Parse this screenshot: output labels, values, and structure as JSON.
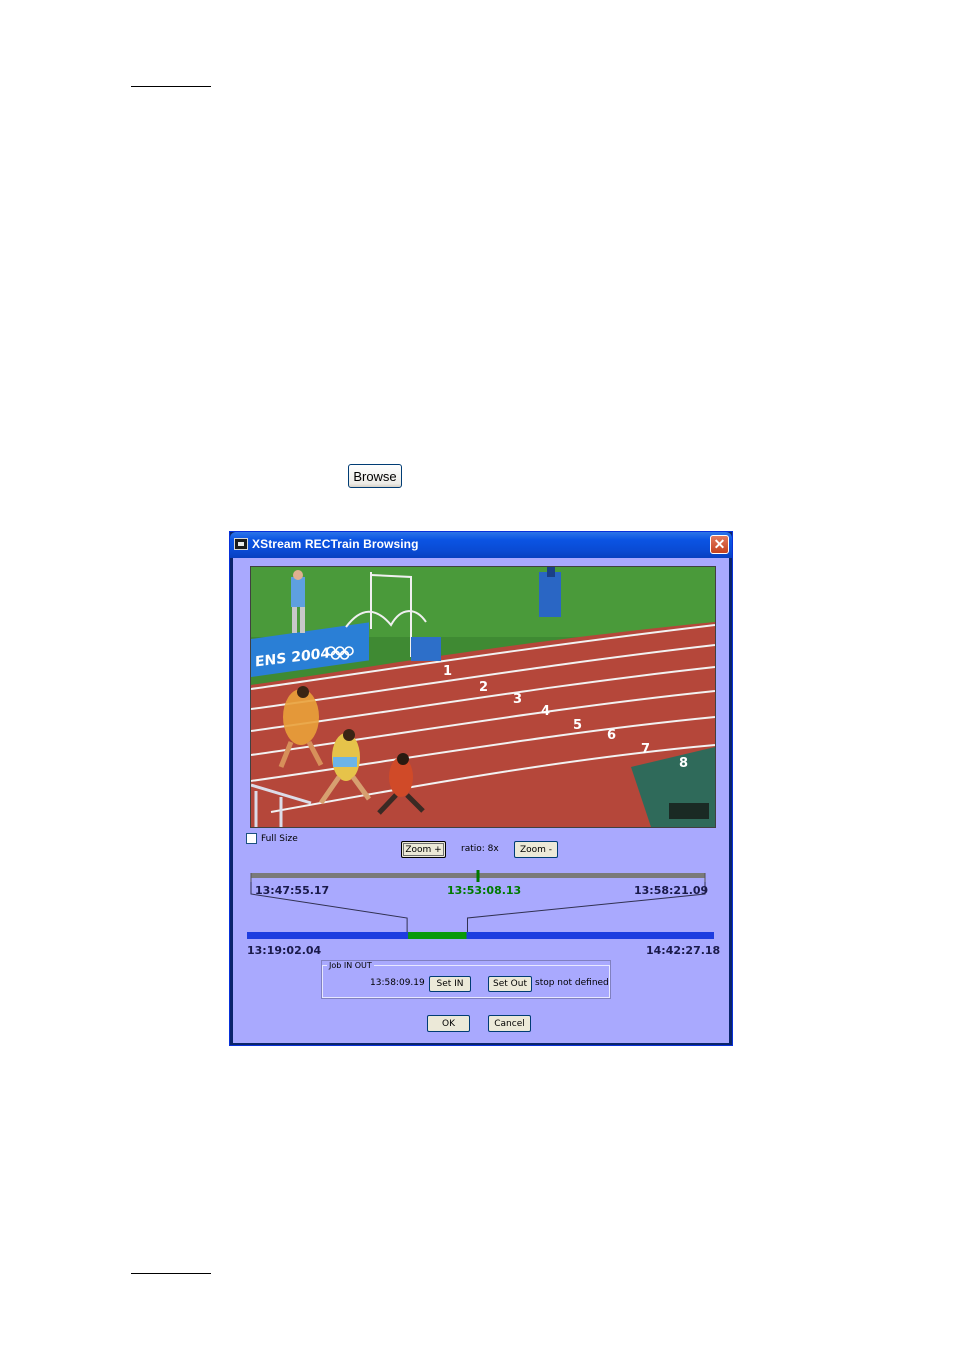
{
  "page": {
    "browse_button_label": "Browse"
  },
  "dialog": {
    "title": "XStream RECTrain  Browsing",
    "close_glyph": "✕",
    "video": {
      "banner_text": "ENS 2004"
    },
    "full_size_label": "Full Size",
    "zoom_plus_label": "Zoom +",
    "ratio_label": "ratio: 8x",
    "zoom_minus_label": "Zoom -",
    "timeline": {
      "zoom_start": "13:47:55.17",
      "zoom_cursor": "13:53:08.13",
      "zoom_end": "13:58:21.09",
      "full_start": "13:19:02.04",
      "full_end": "14:42:27.18",
      "cursor_fraction_in_zoom": 0.5,
      "zoom_window_start_fraction": 0.345,
      "zoom_window_end_fraction": 0.47
    },
    "job": {
      "legend": "Job IN OUT",
      "in_time": "13:58:09.19",
      "set_in_label": "Set IN",
      "set_out_label": "Set Out",
      "out_status": "stop not defined"
    },
    "ok_label": "OK",
    "cancel_label": "Cancel"
  },
  "colors": {
    "client_bg": "#a9a9fe",
    "timeline_blue": "#1d3de0",
    "timeline_green": "#0a9a0a",
    "cursor_green": "#007a00"
  },
  "icons": [
    "window-icon",
    "close-icon"
  ]
}
